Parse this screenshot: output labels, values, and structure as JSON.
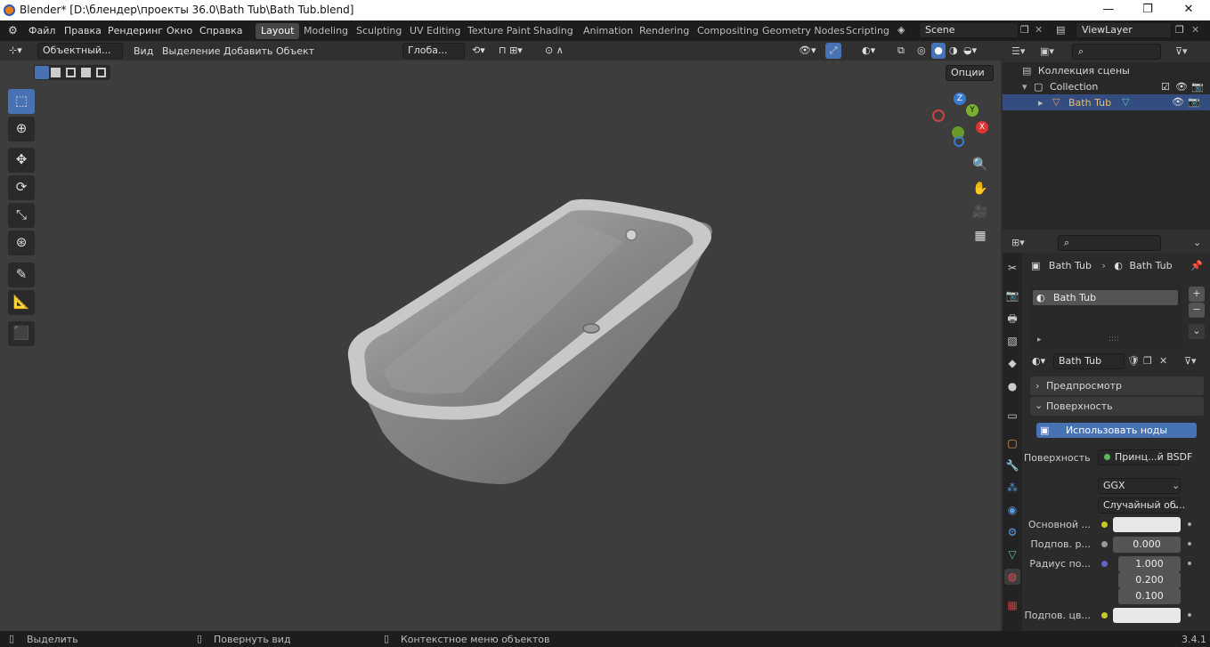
{
  "title": "Blender* [D:\\блендер\\проекты 36.0\\Bath Tub\\Bath Tub.blend]",
  "window_controls": [
    "—",
    "❐",
    "✕"
  ],
  "menu": [
    "Файл",
    "Правка",
    "Рендеринг",
    "Окно",
    "Справка"
  ],
  "workspaces": [
    "Layout",
    "Modeling",
    "Sculpting",
    "UV Editing",
    "Texture Paint",
    "Shading",
    "Animation",
    "Rendering",
    "Compositing",
    "Geometry Nodes",
    "Scripting"
  ],
  "active_workspace": "Layout",
  "scene": "Scene",
  "view_layer": "ViewLayer",
  "viewport": {
    "mode": "Объектный...",
    "menus": [
      "Вид",
      "Выделение",
      "Добавить",
      "Объект"
    ],
    "orientation": "Глоба...",
    "options_label": "Опции",
    "gizmo": {
      "x": "X",
      "y": "Y",
      "z": "Z"
    }
  },
  "outliner": {
    "root": "Коллекция сцены",
    "collection": "Collection",
    "object": "Bath Tub"
  },
  "properties": {
    "breadcrumb_object": "Bath Tub",
    "breadcrumb_material": "Bath Tub",
    "slot_name": "Bath Tub",
    "material_name": "Bath Tub",
    "preview_label": "Предпросмотр",
    "surface_label": "Поверхность",
    "use_nodes_button": "Использовать ноды",
    "surface_field_label": "Поверхность",
    "surface_shader": "Принц...й BSDF",
    "distribution": "GGX",
    "subsurface_method": "Случайный об...",
    "base_color_label": "Основной ...",
    "subsurface_label": "Подпов. р...",
    "subsurface_value": "0.000",
    "radius_label": "Радиус по...",
    "radius_values": [
      "1.000",
      "0.200",
      "0.100"
    ],
    "subsurface_color_label": "Подпов. цв..."
  },
  "statusbar": {
    "select": "Выделить",
    "rotate": "Повернуть вид",
    "context": "Контекстное меню объектов",
    "version": "3.4.1"
  },
  "colors": {
    "accent": "#4772b3",
    "selected_row": "#334d80",
    "button": "#4772b3"
  }
}
